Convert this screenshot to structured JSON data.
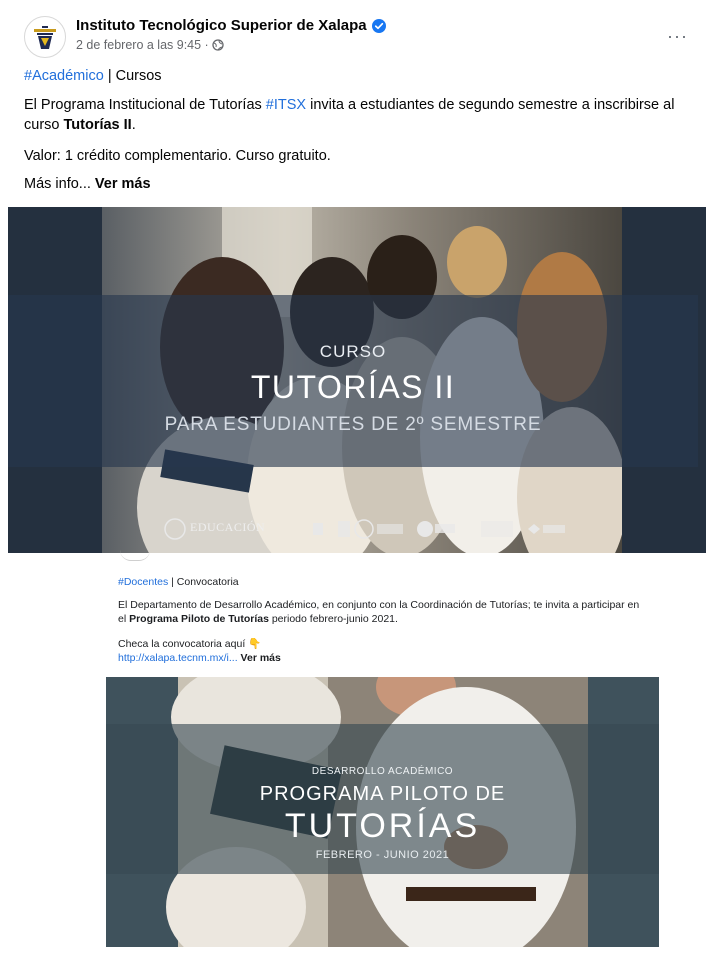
{
  "post1": {
    "page_name": "Instituto Tecnológico Superior de Xalapa",
    "meta": "2 de febrero a las 9:45 · ",
    "more_label": "···",
    "hashtag": "#Académico",
    "category": " | Cursos",
    "line2_a": "El Programa Institucional de Tutorías ",
    "line2_hashtag": "#ITSX",
    "line2_b": " invita a estudiantes de segundo semestre a inscribirse al curso ",
    "line2_bold": "Tutorías II",
    "line2_end": ".",
    "line3": "Valor: 1 crédito complementario. Curso gratuito.",
    "line4_a": "Más info... ",
    "see_more": "Ver más",
    "image": {
      "overline": "CURSO",
      "title": "TUTORÍAS II",
      "subtitle": "PARA ESTUDIANTES DE 2º SEMESTRE",
      "logo_educacion": "EDUCACIÓN"
    }
  },
  "post2": {
    "hashtag": "#Docentes",
    "category": " | Convocatoria",
    "line2_a": "El Departamento de Desarrollo Académico, en conjunto con la Coordinación de Tutorías; te invita a participar en el ",
    "line2_bold": "Programa Piloto de Tutorías",
    "line2_b": " periodo febrero-junio 2021.",
    "line3": "Checa la convocatoria aquí 👇",
    "link": "http://xalapa.tecnm.mx/i...",
    "see_more": " Ver más",
    "image": {
      "overline": "DESARROLLO ACADÉMICO",
      "title": "PROGRAMA PILOTO DE",
      "big": "TUTORÍAS",
      "dates": "FEBRERO - JUNIO 2021"
    }
  },
  "colors": {
    "link": "#216fdb",
    "verified": "#1877f2",
    "band": "#26374e"
  }
}
